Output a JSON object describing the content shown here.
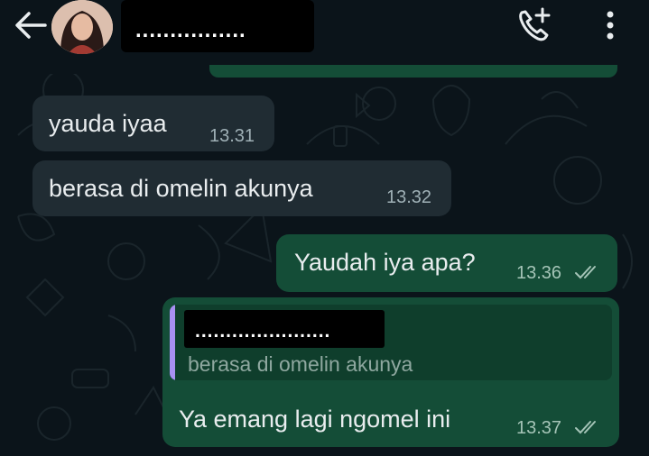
{
  "header": {
    "contact_name": "................",
    "back_icon": "arrow-left-icon",
    "call_icon": "add-call-icon",
    "menu_icon": "more-vert-icon"
  },
  "messages": [
    {
      "direction": "in",
      "text": "yauda iyaa",
      "time": "13.31"
    },
    {
      "direction": "in",
      "text": "berasa di omelin akunya",
      "time": "13.32"
    },
    {
      "direction": "out",
      "text": "Yaudah iya apa?",
      "time": "13.36",
      "status": "read"
    },
    {
      "direction": "out",
      "text": "Ya emang lagi ngomel ini",
      "time": "13.37",
      "status": "read",
      "quoted": {
        "sender": "......................",
        "text": "berasa di omelin akunya"
      }
    }
  ],
  "colors": {
    "background": "#0b141a",
    "incoming_bubble": "#202c33",
    "outgoing_bubble": "#144d37",
    "quote_accent": "#a890f2"
  }
}
